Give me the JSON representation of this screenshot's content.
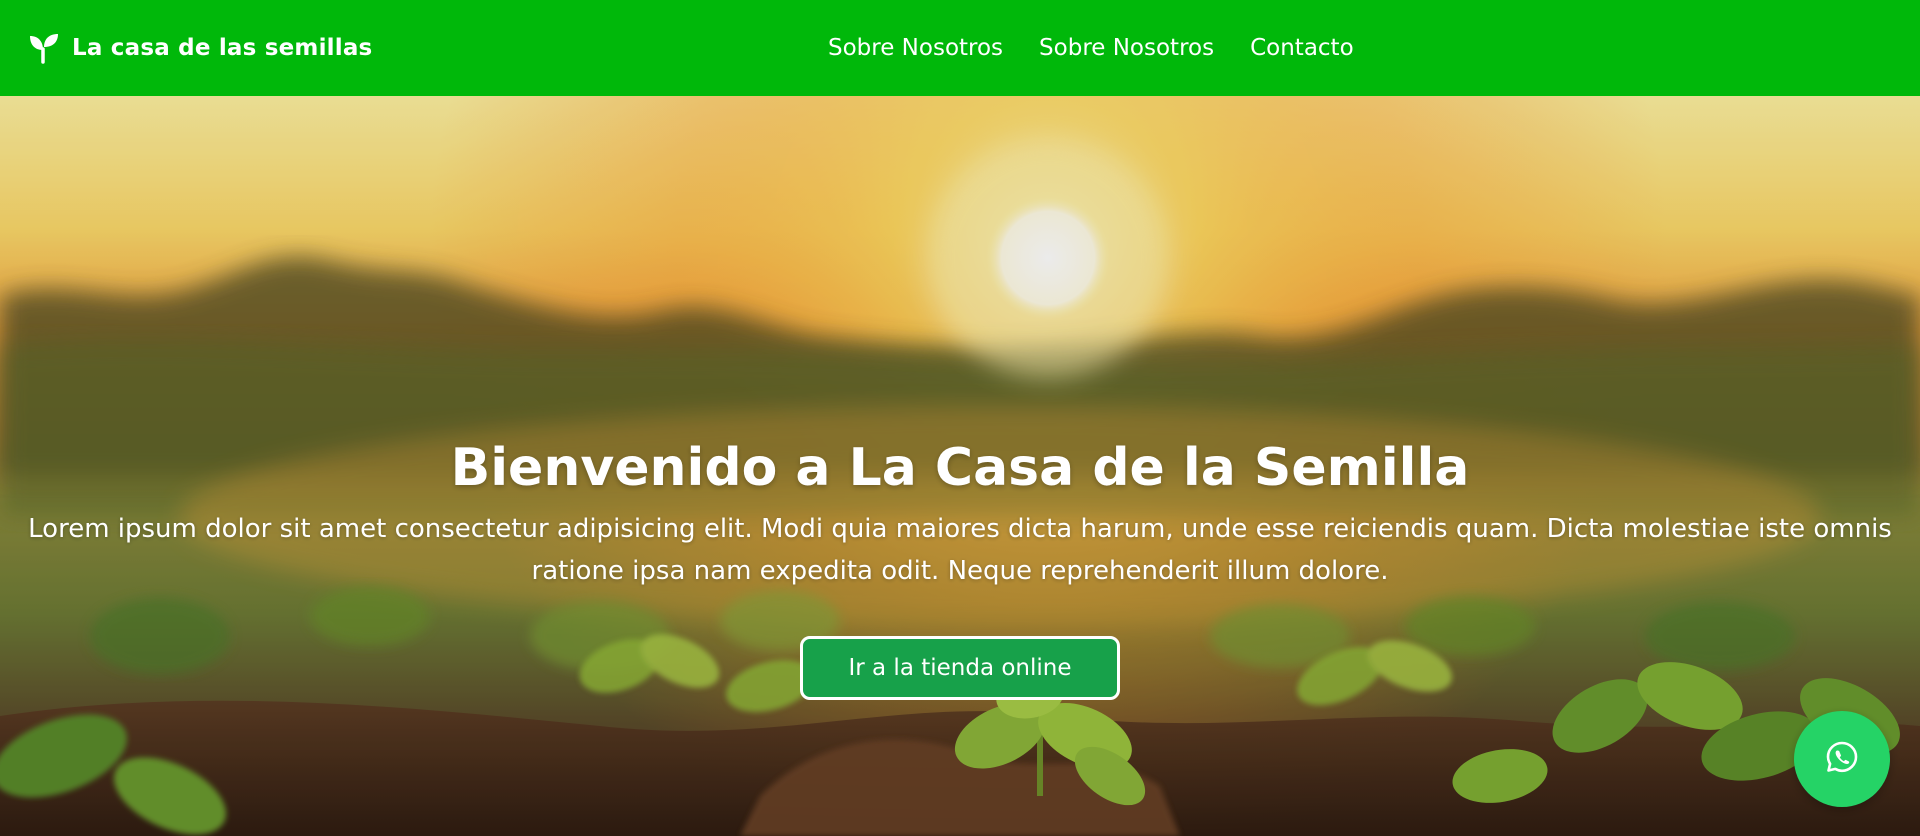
{
  "navbar": {
    "brand_icon": "sprout-icon",
    "brand_text": "La casa de las semillas",
    "links": [
      {
        "label": "Sobre Nosotros"
      },
      {
        "label": "Sobre Nosotros"
      },
      {
        "label": "Contacto"
      }
    ],
    "background_color": "#00b80a"
  },
  "hero": {
    "title": "Bienvenido a La Casa de la Semilla",
    "text": "Lorem ipsum dolor sit amet consectetur adipisicing elit. Modi quia maiores dicta harum, unde esse reiciendis quam. Dicta molestiae iste omnis ratione ipsa nam expedita odit. Neque reprehenderit illum dolore.",
    "cta_label": "Ir a la tienda online",
    "cta_color": "#17a14a"
  },
  "floating": {
    "whatsapp_icon": "whatsapp-icon",
    "whatsapp_color": "#25d366"
  }
}
